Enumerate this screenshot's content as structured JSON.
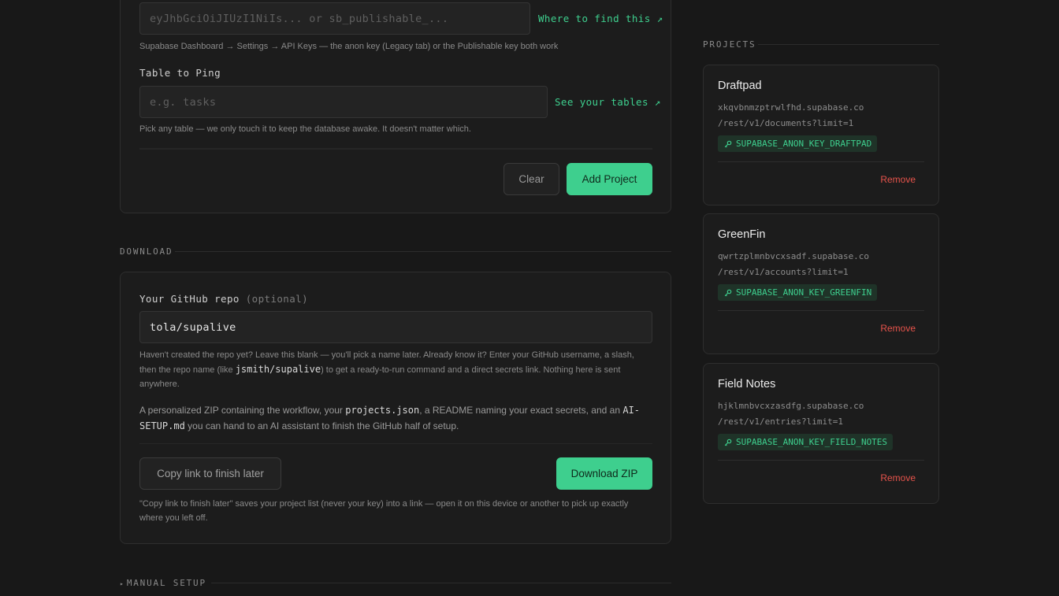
{
  "form": {
    "api_key": {
      "placeholder": "eyJhbGciOiJIUzI1NiIs... or sb_publishable_...",
      "link": "Where to find this ↗",
      "help": "Supabase Dashboard → Settings → API Keys — the anon key (Legacy tab) or the Publishable key both work"
    },
    "table": {
      "label": "Table to Ping",
      "placeholder": "e.g. tasks",
      "link": "See your tables ↗",
      "help": "Pick any table — we only touch it to keep the database awake. It doesn't matter which."
    },
    "clear_label": "Clear",
    "add_label": "Add Project"
  },
  "download": {
    "section_title": "DOWNLOAD",
    "repo_label": "Your GitHub repo",
    "repo_optional": "(optional)",
    "repo_value": "tola/supalive",
    "repo_help_1": "Haven't created the repo yet? Leave this blank — you'll pick a name later. Already know it? Enter your GitHub username, a slash, then the repo name (like",
    "repo_help_code": "jsmith/supalive",
    "repo_help_2": ") to get a ready-to-run command and a direct secrets link. Nothing here is sent anywhere.",
    "zip_desc_1": "A personalized ZIP containing the workflow, your",
    "zip_desc_code1": "projects.json",
    "zip_desc_2": ", a README naming your exact secrets, and an",
    "zip_desc_code2": "AI-SETUP.md",
    "zip_desc_3": "you can hand to an AI assistant to finish the GitHub half of setup.",
    "copy_link_label": "Copy link to finish later",
    "download_label": "Download ZIP",
    "footnote": "\"Copy link to finish later\" saves your project list (never your key) into a link — open it on this device or another to pick up exactly where you left off."
  },
  "manual": {
    "arrow": "▸",
    "title": "MANUAL SETUP"
  },
  "projects": {
    "title": "PROJECTS",
    "remove_label": "Remove",
    "items": [
      {
        "name": "Draftpad",
        "host": "xkqvbnmzptrwlfhd.supabase.co",
        "path": "/rest/v1/documents?limit=1",
        "key": "SUPABASE_ANON_KEY_DRAFTPAD"
      },
      {
        "name": "GreenFin",
        "host": "qwrtzplmnbvcxsadf.supabase.co",
        "path": "/rest/v1/accounts?limit=1",
        "key": "SUPABASE_ANON_KEY_GREENFIN"
      },
      {
        "name": "Field Notes",
        "host": "hjklmnbvcxzasdfg.supabase.co",
        "path": "/rest/v1/entries?limit=1",
        "key": "SUPABASE_ANON_KEY_FIELD_NOTES"
      }
    ]
  },
  "colors": {
    "accent": "#3ecf8e",
    "danger": "#e5534b",
    "background": "#181818"
  }
}
